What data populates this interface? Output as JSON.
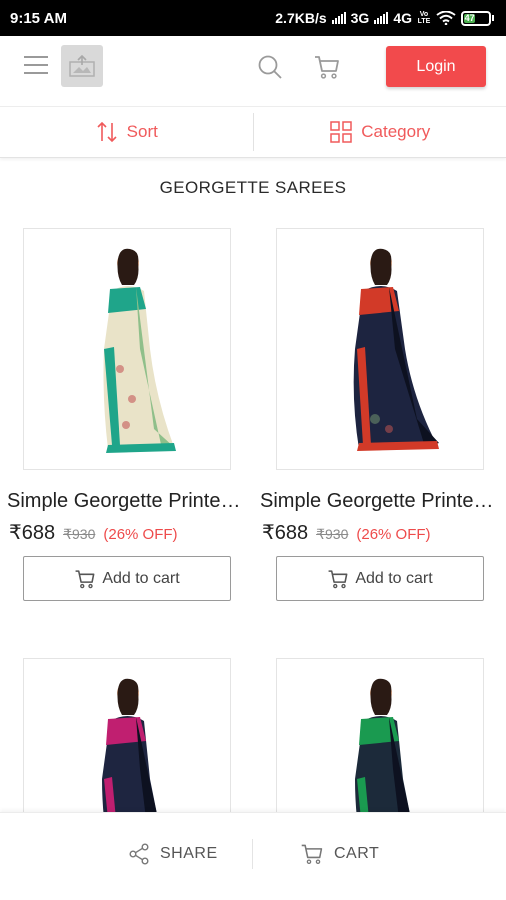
{
  "status_bar": {
    "time": "9:15 AM",
    "network_speed": "2.7KB/s",
    "network_1": "3G",
    "network_2": "4G",
    "volte": "Vo LTE",
    "battery": "47"
  },
  "header": {
    "menu_icon": "hamburger-menu-icon",
    "logo_icon": "image-placeholder-icon",
    "search_icon": "search-icon",
    "cart_icon": "cart-icon",
    "login_label": "Login"
  },
  "filters": {
    "sort_label": "Sort",
    "category_label": "Category"
  },
  "page_title": "GEORGETTE SAREES",
  "products": [
    {
      "name": "Simple Georgette Printed Saree",
      "price": "₹688",
      "mrp": "₹930",
      "discount": "(26% OFF)",
      "button": "Add to cart",
      "colors": [
        "#1fa58a",
        "#e9e3c8",
        "#8fbf8a"
      ]
    },
    {
      "name": "Simple Georgette Printed Saree",
      "price": "₹688",
      "mrp": "₹930",
      "discount": "(26% OFF)",
      "button": "Add to cart",
      "colors": [
        "#d23a28",
        "#1d2440",
        "#0d1120"
      ]
    },
    {
      "name": "",
      "price": "",
      "mrp": "",
      "discount": "",
      "button": "",
      "colors": [
        "#c01f70",
        "#1e2540",
        "#0d1120"
      ]
    },
    {
      "name": "",
      "price": "",
      "mrp": "",
      "discount": "",
      "button": "",
      "colors": [
        "#1a9a50",
        "#1c2a3a",
        "#0d1120"
      ]
    }
  ],
  "bottom_bar": {
    "share_label": "SHARE",
    "cart_label": "CART"
  },
  "colors": {
    "accent": "#f24a4c",
    "filter_text": "#f05a5b",
    "status_bar": "#000000"
  }
}
